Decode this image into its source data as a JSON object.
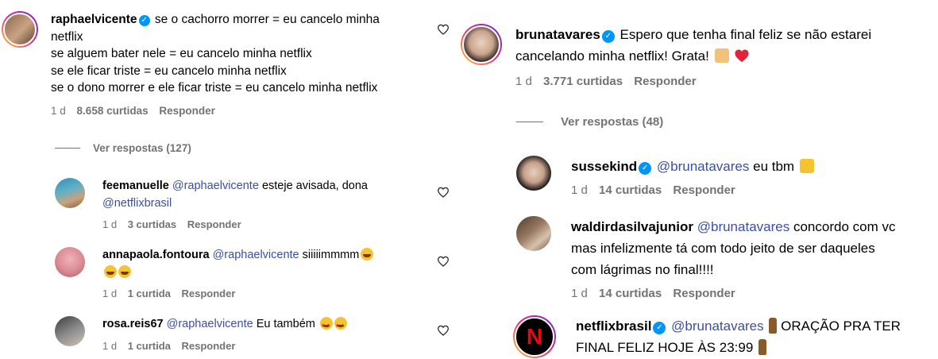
{
  "comments_left": [
    {
      "username": "raphaelvicente",
      "verified": true,
      "lines": [
        "se o cachorro morrer = eu cancelo minha",
        "netflix",
        "se alguem bater nele = eu cancelo minha netflix",
        "se ele ficar triste = eu cancelo minha netflix",
        "se o dono morrer e ele ficar triste = eu cancelo minha netflix"
      ],
      "time": "1 d",
      "likes": "8.658 curtidas",
      "reply": "Responder",
      "view_replies": "Ver respostas (127)"
    },
    {
      "username": "feemanuelle",
      "mention": "@raphaelvicente",
      "text": "esteje avisada, dona",
      "mention2": "@netflixbrasil",
      "time": "1 d",
      "likes": "3 curtidas",
      "reply": "Responder"
    },
    {
      "username": "annapaola.fontoura",
      "mention": "@raphaelvicente",
      "text": "siiiiimmmm",
      "time": "1 d",
      "likes": "1 curtida",
      "reply": "Responder"
    },
    {
      "username": "rosa.reis67",
      "mention": "@raphaelvicente",
      "text": "Eu também",
      "time": "1 d",
      "likes": "1 curtida",
      "reply": "Responder"
    }
  ],
  "comments_right": [
    {
      "username": "brunatavares",
      "verified": true,
      "line1": "Espero que tenha final feliz se não estarei",
      "line2": "cancelando minha netflix! Grata!",
      "time": "1 d",
      "likes": "3.771 curtidas",
      "reply": "Responder",
      "view_replies": "Ver respostas (48)"
    },
    {
      "username": "sussekind",
      "verified": true,
      "mention": "@brunatavares",
      "text": "eu tbm",
      "time": "1 d",
      "likes": "14 curtidas",
      "reply": "Responder"
    },
    {
      "username": "waldirdasilvajunior",
      "mention": "@brunatavares",
      "line1": "concordo com vc",
      "line2": "mas infelizmente tá com todo jeito de ser daqueles",
      "line3": "com lágrimas no final!!!!",
      "time": "1 d",
      "likes": "14 curtidas",
      "reply": "Responder"
    },
    {
      "username": "netflixbrasil",
      "verified": true,
      "mention": "@brunatavares",
      "line1": "ORAÇÃO PRA TER",
      "line2": "FINAL FELIZ HOJE ÀS 23:99",
      "avatar_letter": "N"
    }
  ],
  "colors": {
    "mention": "#3a4fa0",
    "verified": "#0095f6",
    "meta": "#737373",
    "netflix_red": "#e50914"
  }
}
